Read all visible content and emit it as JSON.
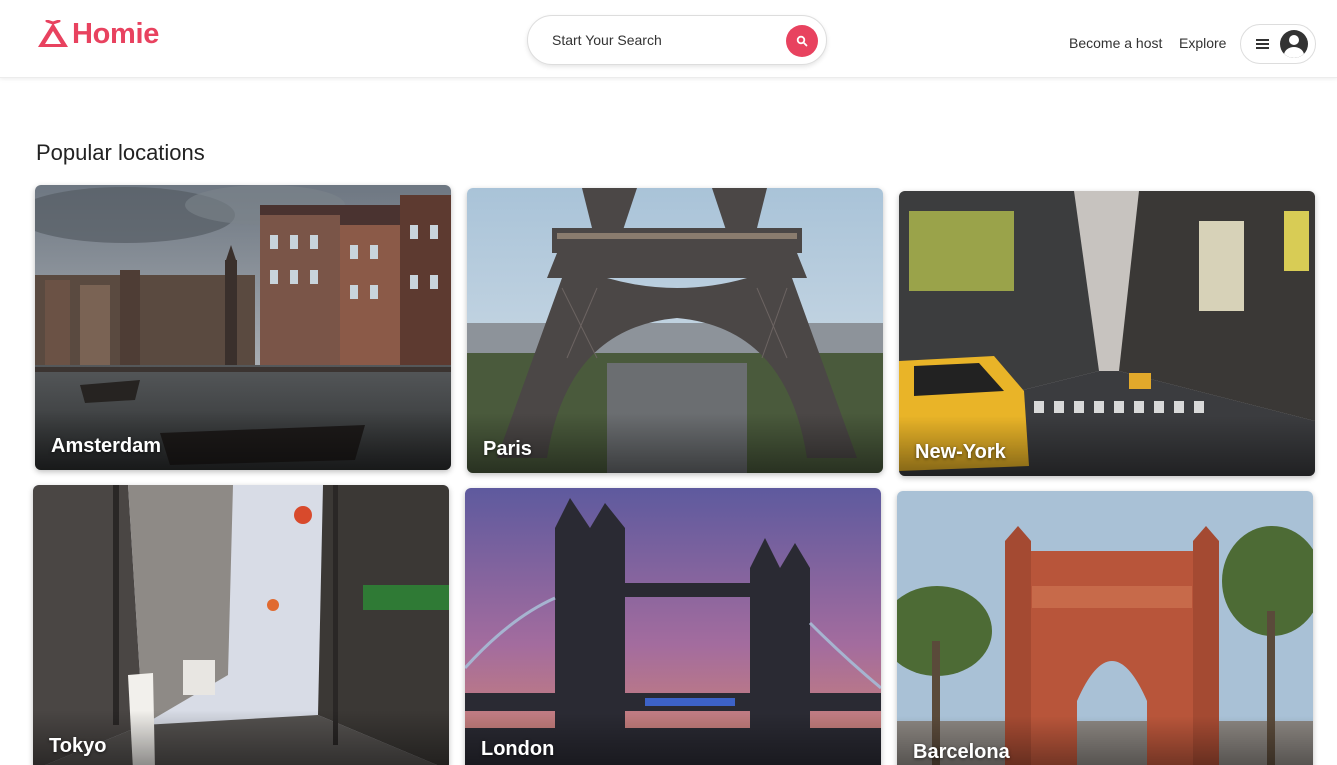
{
  "header": {
    "logo_text": "Homie",
    "search_label": "Start Your Search",
    "nav": {
      "become_host": "Become a host",
      "explore": "Explore"
    },
    "brand_color": "#e8425f"
  },
  "main": {
    "section_title": "Popular locations",
    "locations": [
      {
        "name": "Amsterdam"
      },
      {
        "name": "Paris"
      },
      {
        "name": "New-York"
      },
      {
        "name": "Tokyo"
      },
      {
        "name": "London"
      },
      {
        "name": "Barcelona"
      }
    ]
  },
  "icons": {
    "logo": "tent-logo-icon",
    "search": "search-icon",
    "menu": "hamburger-menu-icon",
    "user": "user-avatar-icon"
  }
}
